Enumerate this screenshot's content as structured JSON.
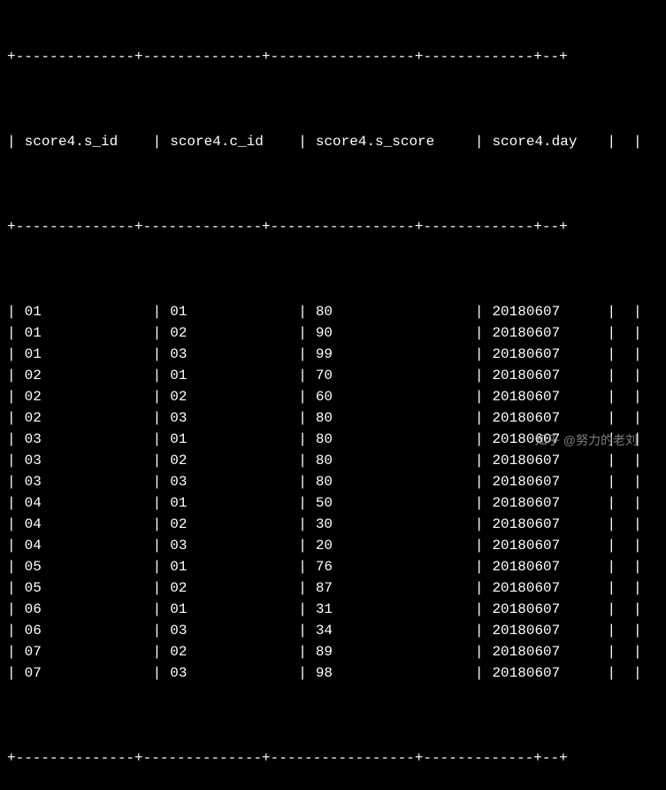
{
  "table": {
    "headers": [
      "score4.s_id",
      "score4.c_id",
      "score4.s_score",
      "score4.day"
    ],
    "rows": [
      {
        "s_id": "01",
        "c_id": "01",
        "s_score": "80",
        "day": "20180607"
      },
      {
        "s_id": "01",
        "c_id": "02",
        "s_score": "90",
        "day": "20180607"
      },
      {
        "s_id": "01",
        "c_id": "03",
        "s_score": "99",
        "day": "20180607"
      },
      {
        "s_id": "02",
        "c_id": "01",
        "s_score": "70",
        "day": "20180607"
      },
      {
        "s_id": "02",
        "c_id": "02",
        "s_score": "60",
        "day": "20180607"
      },
      {
        "s_id": "02",
        "c_id": "03",
        "s_score": "80",
        "day": "20180607"
      },
      {
        "s_id": "03",
        "c_id": "01",
        "s_score": "80",
        "day": "20180607"
      },
      {
        "s_id": "03",
        "c_id": "02",
        "s_score": "80",
        "day": "20180607"
      },
      {
        "s_id": "03",
        "c_id": "03",
        "s_score": "80",
        "day": "20180607"
      },
      {
        "s_id": "04",
        "c_id": "01",
        "s_score": "50",
        "day": "20180607"
      },
      {
        "s_id": "04",
        "c_id": "02",
        "s_score": "30",
        "day": "20180607"
      },
      {
        "s_id": "04",
        "c_id": "03",
        "s_score": "20",
        "day": "20180607"
      },
      {
        "s_id": "05",
        "c_id": "01",
        "s_score": "76",
        "day": "20180607"
      },
      {
        "s_id": "05",
        "c_id": "02",
        "s_score": "87",
        "day": "20180607"
      },
      {
        "s_id": "06",
        "c_id": "01",
        "s_score": "31",
        "day": "20180607"
      },
      {
        "s_id": "06",
        "c_id": "03",
        "s_score": "34",
        "day": "20180607"
      },
      {
        "s_id": "07",
        "c_id": "02",
        "s_score": "89",
        "day": "20180607"
      },
      {
        "s_id": "07",
        "c_id": "03",
        "s_score": "98",
        "day": "20180607"
      }
    ],
    "border_line": "+--------------+--------------+-----------------+-------------+--+"
  },
  "watermark": "知乎 @努力的老刘"
}
